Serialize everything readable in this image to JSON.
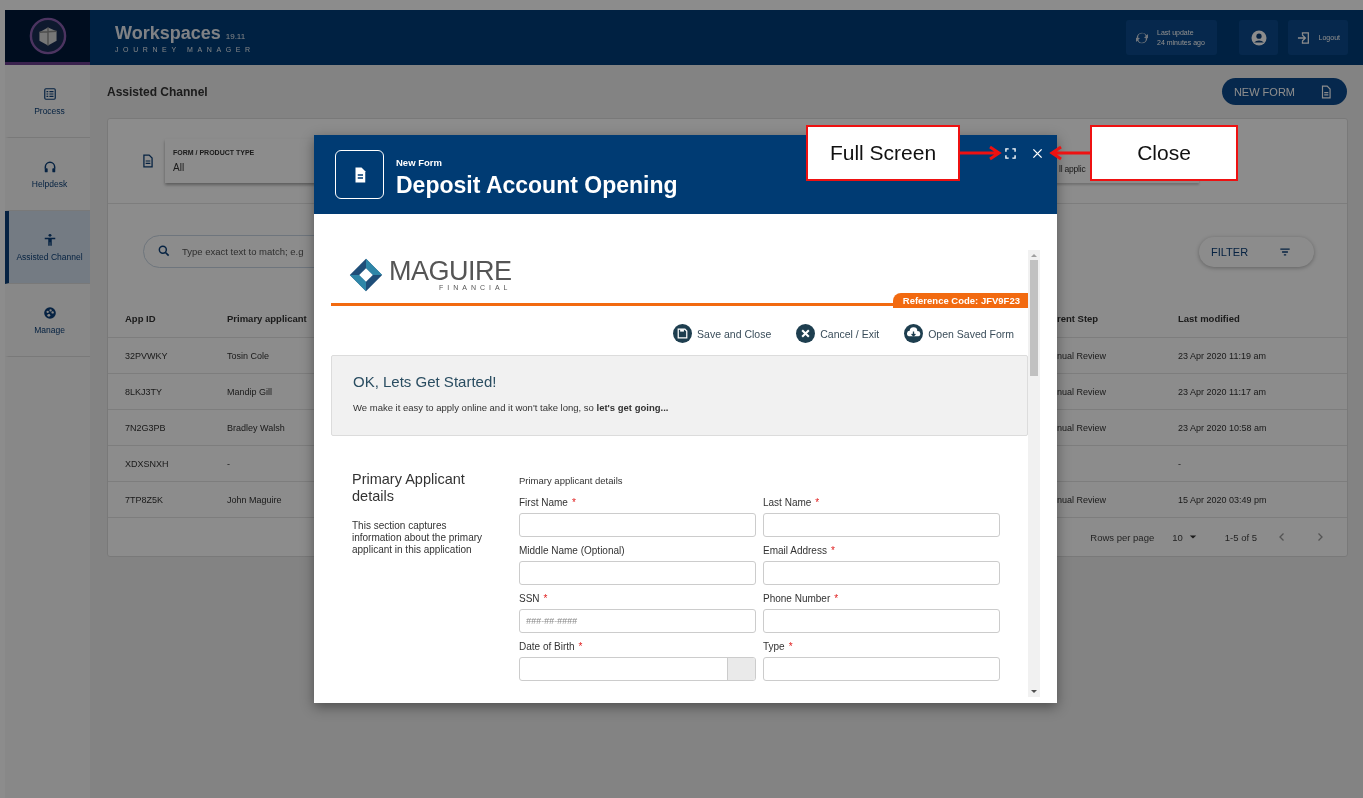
{
  "header": {
    "title": "Workspaces",
    "version": "19.11",
    "subtitle": "JOURNEY MANAGER",
    "last_update_label": "Last update",
    "last_update_value": "24 minutes ago",
    "logout": "Logout"
  },
  "sidebar": {
    "items": [
      {
        "label": "Process",
        "selected": false
      },
      {
        "label": "Helpdesk",
        "selected": false
      },
      {
        "label": "Assisted Channel",
        "selected": true
      },
      {
        "label": "Manage",
        "selected": false
      }
    ]
  },
  "page": {
    "title": "Assisted Channel",
    "new_form_button": "NEW FORM"
  },
  "filters": {
    "form_type": {
      "label": "FORM / PRODUCT TYPE",
      "value": "All"
    },
    "second_value": "ll applic"
  },
  "search": {
    "placeholder": "Type exact text to match; e.g"
  },
  "filter_button": "FILTER",
  "table": {
    "columns": [
      "App ID",
      "Primary applicant",
      "rent Step",
      "Last modified"
    ],
    "rows": [
      {
        "app_id": "32PVWKY",
        "applicant": "Tosin Cole",
        "step": "nual Review",
        "modified": "23 Apr 2020 11:19 am"
      },
      {
        "app_id": "8LKJ3TY",
        "applicant": "Mandip Gill",
        "step": "nual Review",
        "modified": "23 Apr 2020 11:17 am"
      },
      {
        "app_id": "7N2G3PB",
        "applicant": "Bradley Walsh",
        "step": "nual Review",
        "modified": "23 Apr 2020 10:58 am"
      },
      {
        "app_id": "XDXSNXH",
        "applicant": "-",
        "modified": "-"
      },
      {
        "app_id": "7TP8Z5K",
        "applicant": "John Maguire",
        "step": "nual Review",
        "modified": "15 Apr 2020 03:49 pm"
      }
    ]
  },
  "pagination": {
    "rows_per_page_label": "Rows per page",
    "rows_per_page": "10",
    "range": "1-5 of 5"
  },
  "modal": {
    "kicker": "New Form",
    "title": "Deposit Account Opening",
    "brand": {
      "name": "MAGUIRE",
      "sub": "FINANCIAL"
    },
    "reference": "Reference Code: JFV9F23",
    "actions": [
      "Save and Close",
      "Cancel / Exit",
      "Open Saved Form"
    ],
    "intro": {
      "heading": "OK, Lets Get Started!",
      "text": "We make it easy to apply online and it won't take long, so **let's get going...**"
    },
    "section": {
      "title": "Primary Applicant details",
      "description": "This section captures information about the primary applicant in this application",
      "group_label": "Primary applicant details",
      "required_mark": "*",
      "fields": [
        {
          "label": "First Name",
          "required": true,
          "kind": "text"
        },
        {
          "label": "Last Name",
          "required": true,
          "kind": "text"
        },
        {
          "label": "Middle Name (Optional)",
          "required": false,
          "kind": "text"
        },
        {
          "label": "Email Address",
          "required": true,
          "kind": "text"
        },
        {
          "label": "SSN",
          "required": true,
          "kind": "text",
          "placeholder": "###-##-####"
        },
        {
          "label": "Phone Number",
          "required": true,
          "kind": "text"
        },
        {
          "label": "Date of Birth",
          "required": true,
          "kind": "date"
        },
        {
          "label": "Type",
          "required": true,
          "kind": "select"
        }
      ]
    }
  },
  "callouts": [
    {
      "text": "Full Screen",
      "kind": "right"
    },
    {
      "text": "Close",
      "kind": "left"
    }
  ]
}
